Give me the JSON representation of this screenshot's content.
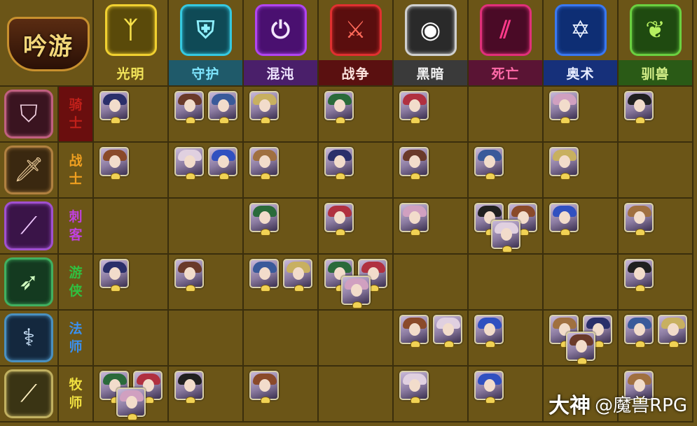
{
  "logo": {
    "text": "吟游"
  },
  "columns": [
    {
      "label": "光明",
      "label_color": "#f3e55a",
      "label_bg": "#6b5517",
      "icon": "light-rune-icon",
      "glyph": "ᛉ",
      "icon_color": "#f6e04a",
      "icon_bg": "#5a4a0a",
      "icon_border": "#f0d030"
    },
    {
      "label": "守护",
      "label_color": "#7fe6ff",
      "label_bg": "#1f5a6a",
      "icon": "shield-icon",
      "glyph": "⛨",
      "icon_color": "#8ff0ff",
      "icon_bg": "#0f4a56",
      "icon_border": "#35c8e0"
    },
    {
      "label": "混沌",
      "label_color": "#f0e6ff",
      "label_bg": "#4a1f6a",
      "icon": "power-icon",
      "glyph": "⏻",
      "icon_color": "#f3e6ff",
      "icon_bg": "#4a1070",
      "icon_border": "#b045f0"
    },
    {
      "label": "战争",
      "label_color": "#ffe6e0",
      "label_bg": "#5a1010",
      "icon": "crossed-swords-icon",
      "glyph": "⚔",
      "icon_color": "#ff6a5a",
      "icon_bg": "#5a0e0e",
      "icon_border": "#e03030"
    },
    {
      "label": "黑暗",
      "label_color": "#f2f2f2",
      "label_bg": "#3a3a3a",
      "icon": "eye-icon",
      "glyph": "◉",
      "icon_color": "#ffffff",
      "icon_bg": "#2a2a2a",
      "icon_border": "#cfcfcf"
    },
    {
      "label": "死亡",
      "label_color": "#ff6aa8",
      "label_bg": "#5a1434",
      "icon": "claw-marks-icon",
      "glyph": "⫽",
      "icon_color": "#ff3a8a",
      "icon_bg": "#4a0a26",
      "icon_border": "#e0307a"
    },
    {
      "label": "奥术",
      "label_color": "#e6ecff",
      "label_bg": "#16307a",
      "icon": "hexagram-icon",
      "glyph": "✡",
      "icon_color": "#e8f0ff",
      "icon_bg": "#0e2e74",
      "icon_border": "#3a78f0"
    },
    {
      "label": "驯兽",
      "label_color": "#d6f08a",
      "label_bg": "#2a5a16",
      "icon": "paw-icon",
      "glyph": "❦",
      "icon_color": "#b6f060",
      "icon_bg": "#1f4a10",
      "icon_border": "#6ad040"
    }
  ],
  "rows": [
    {
      "label_top": "骑",
      "label_bottom": "士",
      "label_color": "#c0201a",
      "label_bg": "#6a0e0e",
      "icon": "knight-crest-icon",
      "glyph": "⛉",
      "icon_color": "#f0d0e0",
      "icon_bg": "#3a1420",
      "icon_border": "#c06080"
    },
    {
      "label_top": "战",
      "label_bottom": "士",
      "label_color": "#f0a020",
      "label_bg": "#6b5517",
      "icon": "sword-icon",
      "glyph": "🗡",
      "icon_color": "#f2d2a0",
      "icon_bg": "#3a2810",
      "icon_border": "#b08040"
    },
    {
      "label_top": "刺",
      "label_bottom": "客",
      "label_color": "#c040e0",
      "label_bg": "#6b5517",
      "icon": "dagger-icon",
      "glyph": "⟋",
      "icon_color": "#f0c8ff",
      "icon_bg": "#3a1448",
      "icon_border": "#a050d0"
    },
    {
      "label_top": "游",
      "label_bottom": "侠",
      "label_color": "#30c040",
      "label_bg": "#6b5517",
      "icon": "bow-icon",
      "glyph": "➶",
      "icon_color": "#d0ffc0",
      "icon_bg": "#143a20",
      "icon_border": "#40b060"
    },
    {
      "label_top": "法",
      "label_bottom": "师",
      "label_color": "#3a90f0",
      "label_bg": "#6b5517",
      "icon": "staff-icon",
      "glyph": "⚕",
      "icon_color": "#d0e8ff",
      "icon_bg": "#14283e",
      "icon_border": "#4a90c0"
    },
    {
      "label_top": "牧",
      "label_bottom": "师",
      "label_color": "#f0e040",
      "label_bg": "#6b5517",
      "icon": "scepter-icon",
      "glyph": "⟋",
      "icon_color": "#fff0c0",
      "icon_bg": "#3a3414",
      "icon_border": "#c0b060"
    }
  ],
  "cells": [
    [
      1,
      2,
      1,
      1,
      1,
      0,
      1,
      1
    ],
    [
      1,
      2,
      1,
      1,
      1,
      1,
      1,
      0
    ],
    [
      0,
      0,
      1,
      1,
      1,
      3,
      1,
      1
    ],
    [
      1,
      1,
      2,
      3,
      0,
      0,
      0,
      1
    ],
    [
      0,
      0,
      0,
      0,
      2,
      1,
      3,
      2
    ],
    [
      3,
      1,
      1,
      0,
      1,
      1,
      0,
      1
    ]
  ],
  "palette": [
    "#2a2f6a",
    "#6a3a2a",
    "#3a5a9a",
    "#c8b060",
    "#2a6a3a",
    "#b03040",
    "#d0a0c0",
    "#202020",
    "#8a4a2a",
    "#e0d0e0",
    "#3050c0",
    "#a07040"
  ],
  "watermark": {
    "main": "大神",
    "sub": "@魔兽RPG"
  }
}
